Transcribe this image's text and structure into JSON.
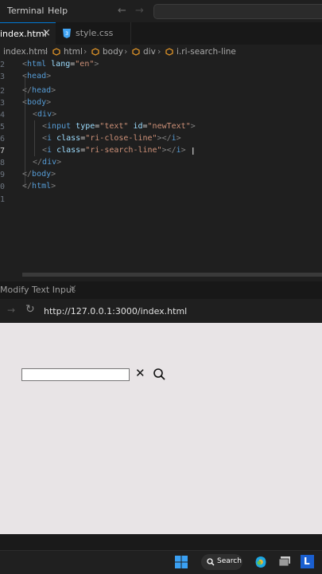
{
  "menu": {
    "terminal": "Terminal",
    "help": "Help"
  },
  "tabs": [
    {
      "label": "index.html",
      "close": "×"
    },
    {
      "label": "style.css"
    }
  ],
  "breadcrumb": [
    "index.html",
    "html",
    "body",
    "div",
    "i.ri-search-line"
  ],
  "code_lines": [
    {
      "num": "2",
      "text": "<html lang=\"en\">"
    },
    {
      "num": "3",
      "text": "<head>"
    },
    {
      "num": "2",
      "text": "</head>"
    },
    {
      "num": "3",
      "text": "<body>"
    },
    {
      "num": "4",
      "text": "<div>"
    },
    {
      "num": "5",
      "text": "<input type=\"text\" id=\"newText\">"
    },
    {
      "num": "6",
      "text": "<i class=\"ri-close-line\"></i>"
    },
    {
      "num": "7",
      "text": "<i class=\"ri-search-line\"></i>"
    },
    {
      "num": "8",
      "text": "</div>"
    },
    {
      "num": "9",
      "text": "</body>"
    },
    {
      "num": "0",
      "text": "</html>"
    },
    {
      "num": "1",
      "text": ""
    }
  ],
  "panel": {
    "tab_label": "Modify Text Input",
    "tab_close": "×"
  },
  "browser": {
    "url": "http://127.0.0.1:3000/index.html",
    "reload": "↻",
    "forward": "→"
  },
  "preview": {
    "close_glyph": "✕"
  },
  "taskbar": {
    "search_label": "Search",
    "user_initial": "L"
  },
  "colors": {
    "accent": "#0078d4",
    "editor_bg": "#1f1f1f",
    "preview_bg": "#e8e4e6"
  }
}
